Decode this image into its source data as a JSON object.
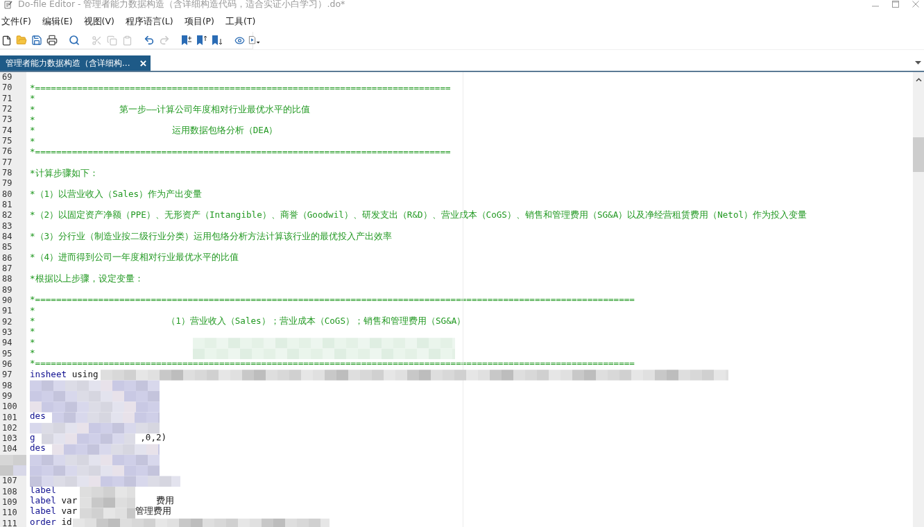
{
  "window": {
    "title": "Do-file Editor - 管理者能力数据构造（含详细构造代码，适合实证小白学习）.do*"
  },
  "menu": [
    "文件(F)",
    "编辑(E)",
    "视图(V)",
    "程序语言(L)",
    "项目(P)",
    "工具(T)"
  ],
  "toolbar": [
    {
      "kind": "new",
      "disabled": false
    },
    {
      "kind": "open",
      "disabled": false
    },
    {
      "kind": "save",
      "disabled": false
    },
    {
      "kind": "print",
      "disabled": false
    },
    {
      "kind": "separator"
    },
    {
      "kind": "find",
      "disabled": false
    },
    {
      "kind": "separator"
    },
    {
      "kind": "cut",
      "disabled": true
    },
    {
      "kind": "copy",
      "disabled": true
    },
    {
      "kind": "paste",
      "disabled": true
    },
    {
      "kind": "separator"
    },
    {
      "kind": "undo",
      "disabled": false
    },
    {
      "kind": "redo",
      "disabled": true
    },
    {
      "kind": "separator"
    },
    {
      "kind": "bookmark-toggle",
      "disabled": false
    },
    {
      "kind": "bookmark-previous",
      "disabled": false
    },
    {
      "kind": "bookmark-next",
      "disabled": false
    },
    {
      "kind": "separator"
    },
    {
      "kind": "watch",
      "disabled": false
    },
    {
      "kind": "run",
      "disabled": false
    }
  ],
  "tabs": [
    {
      "label": "管理者能力数据构造（含详细构...",
      "selected": true,
      "close": "×"
    }
  ],
  "editor": {
    "redaction": {
      "kind": "mosaic"
    },
    "lines": [
      {
        "number": "69"
      },
      {
        "number": "70",
        "segments": [
          {
            "kind": "comment",
            "text": "*==============================================================================="
          }
        ]
      },
      {
        "number": "71",
        "segments": [
          {
            "kind": "comment",
            "text": "*"
          }
        ]
      },
      {
        "number": "72",
        "segments": [
          {
            "kind": "comment",
            "text": "*"
          },
          {
            "kind": "comment",
            "text": "                第一步——计算公司年度相对行业最优水平的比值"
          }
        ]
      },
      {
        "number": "73",
        "segments": [
          {
            "kind": "comment",
            "text": "*"
          }
        ]
      },
      {
        "number": "74",
        "segments": [
          {
            "kind": "comment",
            "text": "*"
          },
          {
            "kind": "comment",
            "text": "                          运用数据包络分析（DEA）"
          }
        ]
      },
      {
        "number": "75",
        "segments": [
          {
            "kind": "comment",
            "text": "*"
          }
        ]
      },
      {
        "number": "76",
        "segments": [
          {
            "kind": "comment",
            "text": "*==============================================================================="
          }
        ]
      },
      {
        "number": "77"
      },
      {
        "number": "78",
        "segments": [
          {
            "kind": "comment",
            "text": "*计算步骤如下："
          }
        ]
      },
      {
        "number": "79"
      },
      {
        "number": "80",
        "segments": [
          {
            "kind": "comment",
            "text": "*（1）以营业收入（Sales）作为产出变量"
          }
        ]
      },
      {
        "number": "81"
      },
      {
        "number": "82",
        "segments": [
          {
            "kind": "comment",
            "text": "*（2）以固定资产净额（PPE）、无形资产（Intangible）、商誉（Goodwil）、研发支出（R&D）、营业成本（CoGS）、销售和管理费用（SG&A）以及净经营租赁费用（Netol）作为投入变量"
          }
        ]
      },
      {
        "number": "83"
      },
      {
        "number": "84",
        "segments": [
          {
            "kind": "comment",
            "text": "*（3）分行业（制造业按二级行业分类）运用包络分析方法计算该行业的最优投入产出效率"
          }
        ]
      },
      {
        "number": "85"
      },
      {
        "number": "86",
        "segments": [
          {
            "kind": "comment",
            "text": "*（4）进而得到公司一年度相对行业最优水平的比值"
          }
        ]
      },
      {
        "number": "87"
      },
      {
        "number": "88",
        "segments": [
          {
            "kind": "comment",
            "text": "*根据以上步骤，设定变量："
          }
        ]
      },
      {
        "number": "89"
      },
      {
        "number": "90",
        "segments": [
          {
            "kind": "comment",
            "text": "*=================================================================================================================="
          }
        ]
      },
      {
        "number": "91",
        "segments": [
          {
            "kind": "comment",
            "text": "*"
          }
        ]
      },
      {
        "number": "92",
        "segments": [
          {
            "kind": "comment",
            "text": "*"
          },
          {
            "kind": "comment",
            "text": "                         （1）营业收入（Sales）；营业成本（CoGS）；销售和管理费用（SG&A）"
          }
        ]
      },
      {
        "number": "93",
        "segments": [
          {
            "kind": "comment",
            "text": "*"
          }
        ]
      },
      {
        "number": "94",
        "segments": [
          {
            "kind": "comment",
            "text": "*"
          }
        ]
      },
      {
        "number": "95",
        "segments": [
          {
            "kind": "comment",
            "text": "*"
          }
        ]
      },
      {
        "number": "96",
        "segments": [
          {
            "kind": "comment",
            "text": "*=================================================================================================================="
          }
        ]
      },
      {
        "number": "97",
        "segments": [
          {
            "kind": "keyword",
            "text": "insheet"
          },
          {
            "kind": "plain",
            "text": " using"
          }
        ]
      },
      {
        "number": "98"
      },
      {
        "number": "99"
      },
      {
        "number": "100"
      },
      {
        "number": "101",
        "segments": [
          {
            "kind": "keyword",
            "text": "des"
          }
        ]
      },
      {
        "number": "102"
      },
      {
        "number": "103",
        "segments": [
          {
            "kind": "keyword",
            "text": "g"
          },
          {
            "kind": "plain",
            "text": "                    ,0,2)"
          }
        ]
      },
      {
        "number": "104",
        "segments": [
          {
            "kind": "keyword",
            "text": "des"
          }
        ]
      },
      {
        "covered": true
      },
      {
        "covered": true
      },
      {
        "number": "107"
      },
      {
        "number": "108",
        "segments": [
          {
            "kind": "keyword",
            "text": "label"
          }
        ]
      },
      {
        "number": "109",
        "segments": [
          {
            "kind": "keyword",
            "text": "label"
          },
          {
            "kind": "plain",
            "text": " var"
          },
          {
            "kind": "plain",
            "text": "               费用"
          }
        ]
      },
      {
        "number": "110",
        "segments": [
          {
            "kind": "keyword",
            "text": "label"
          },
          {
            "kind": "plain",
            "text": " var"
          },
          {
            "kind": "plain",
            "text": "           管理费用"
          }
        ]
      },
      {
        "number": "111",
        "segments": [
          {
            "kind": "keyword",
            "text": "order"
          },
          {
            "kind": "plain",
            "text": " id"
          }
        ]
      }
    ]
  }
}
